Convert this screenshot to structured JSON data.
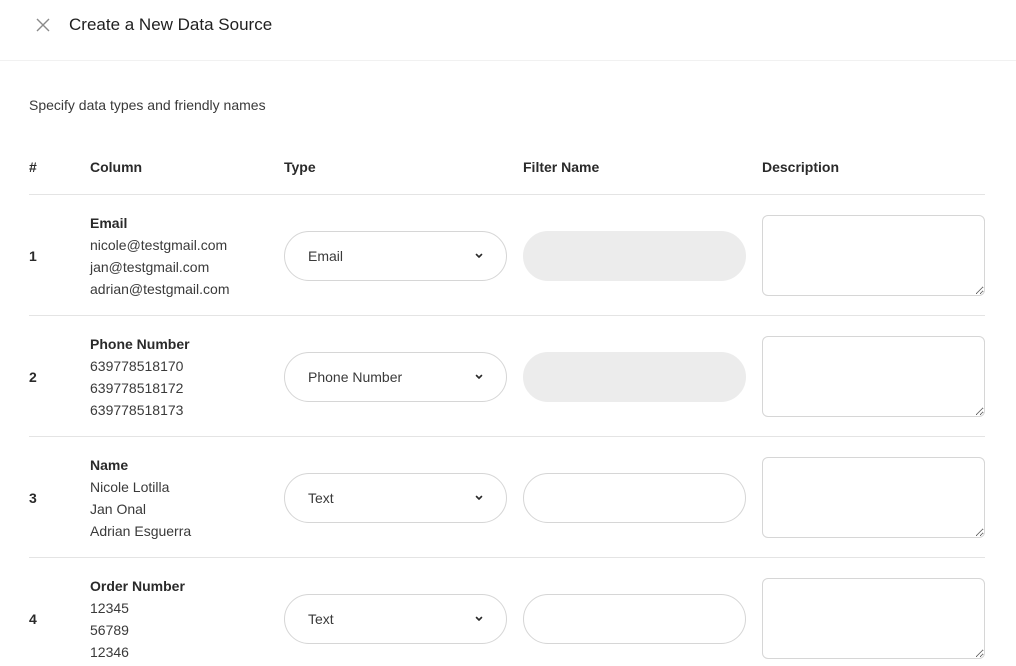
{
  "header": {
    "title": "Create a New Data Source",
    "close_icon": "close-icon"
  },
  "subtitle": "Specify data types and friendly names",
  "table": {
    "headers": {
      "num": "#",
      "column": "Column",
      "type": "Type",
      "filter": "Filter Name",
      "description": "Description"
    },
    "rows": [
      {
        "num": "1",
        "column": "Email",
        "samples": [
          "nicole@testgmail.com",
          "jan@testgmail.com",
          "adrian@testgmail.com"
        ],
        "type": "Email",
        "filter_name": "",
        "filter_disabled": true,
        "description": ""
      },
      {
        "num": "2",
        "column": "Phone Number",
        "samples": [
          "639778518170",
          "639778518172",
          "639778518173"
        ],
        "type": "Phone Number",
        "filter_name": "",
        "filter_disabled": true,
        "description": ""
      },
      {
        "num": "3",
        "column": "Name",
        "samples": [
          "Nicole Lotilla",
          "Jan Onal",
          "Adrian Esguerra"
        ],
        "type": "Text",
        "filter_name": "",
        "filter_disabled": false,
        "description": ""
      },
      {
        "num": "4",
        "column": "Order Number",
        "samples": [
          "12345",
          "56789",
          "12346"
        ],
        "type": "Text",
        "filter_name": "",
        "filter_disabled": false,
        "description": ""
      }
    ]
  },
  "colors": {
    "border": "#d6d6d6",
    "disabled_fill": "#ececec",
    "divider": "#e4e4e4"
  }
}
